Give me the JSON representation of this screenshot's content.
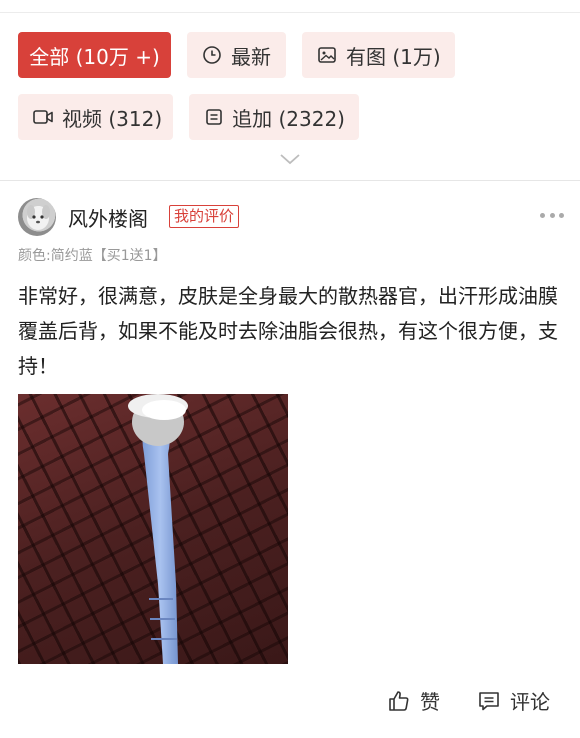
{
  "filters": [
    {
      "label": "全部 (10万 +)",
      "icon": "",
      "active": true
    },
    {
      "label": "最新",
      "icon": "clock-icon",
      "active": false
    },
    {
      "label": "有图 (1万)",
      "icon": "image-icon",
      "active": false
    },
    {
      "label": "视频 (312)",
      "icon": "video-icon",
      "active": false
    },
    {
      "label": "追加 (2322)",
      "icon": "append-icon",
      "active": false
    }
  ],
  "expand_icon": "chevron-down-icon",
  "review": {
    "username": "风外楼阁",
    "badge": "我的评价",
    "sku": "颜色:简约蓝【买1送1】",
    "text": "非常好，很满意，皮肤是全身最大的散热器官，出汗形成油膜覆盖后背，如果不能及时去除油脂会很热，有这个很方便，支持！",
    "more_icon": "more-dots-icon",
    "image_alt_icon": "review-photo"
  },
  "actions": {
    "like_label": "赞",
    "comment_label": "评论"
  },
  "colors": {
    "accent": "#d8413a",
    "chip_bg": "#fbecea",
    "muted_text": "#999999"
  }
}
